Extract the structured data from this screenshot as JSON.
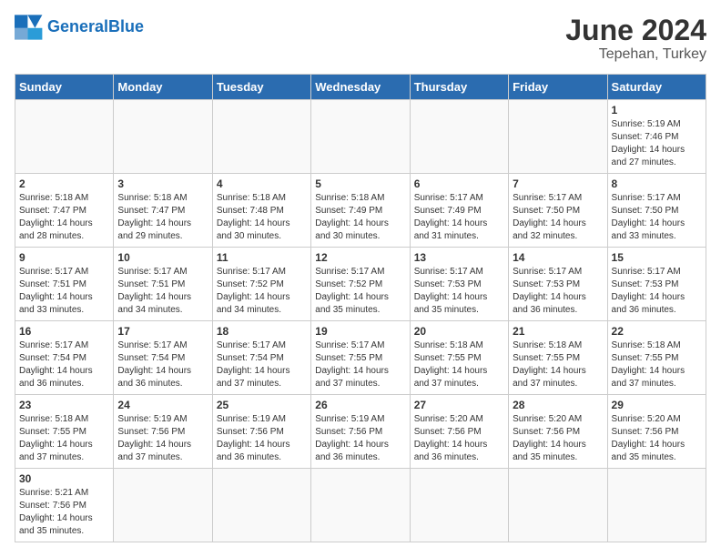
{
  "header": {
    "logo_general": "General",
    "logo_blue": "Blue",
    "month_year": "June 2024",
    "location": "Tepehan, Turkey"
  },
  "weekdays": [
    "Sunday",
    "Monday",
    "Tuesday",
    "Wednesday",
    "Thursday",
    "Friday",
    "Saturday"
  ],
  "weeks": [
    [
      {
        "day": "",
        "info": ""
      },
      {
        "day": "",
        "info": ""
      },
      {
        "day": "",
        "info": ""
      },
      {
        "day": "",
        "info": ""
      },
      {
        "day": "",
        "info": ""
      },
      {
        "day": "",
        "info": ""
      },
      {
        "day": "1",
        "info": "Sunrise: 5:19 AM\nSunset: 7:46 PM\nDaylight: 14 hours\nand 27 minutes."
      }
    ],
    [
      {
        "day": "2",
        "info": "Sunrise: 5:18 AM\nSunset: 7:47 PM\nDaylight: 14 hours\nand 28 minutes."
      },
      {
        "day": "3",
        "info": "Sunrise: 5:18 AM\nSunset: 7:47 PM\nDaylight: 14 hours\nand 29 minutes."
      },
      {
        "day": "4",
        "info": "Sunrise: 5:18 AM\nSunset: 7:48 PM\nDaylight: 14 hours\nand 30 minutes."
      },
      {
        "day": "5",
        "info": "Sunrise: 5:18 AM\nSunset: 7:49 PM\nDaylight: 14 hours\nand 30 minutes."
      },
      {
        "day": "6",
        "info": "Sunrise: 5:17 AM\nSunset: 7:49 PM\nDaylight: 14 hours\nand 31 minutes."
      },
      {
        "day": "7",
        "info": "Sunrise: 5:17 AM\nSunset: 7:50 PM\nDaylight: 14 hours\nand 32 minutes."
      },
      {
        "day": "8",
        "info": "Sunrise: 5:17 AM\nSunset: 7:50 PM\nDaylight: 14 hours\nand 33 minutes."
      }
    ],
    [
      {
        "day": "9",
        "info": "Sunrise: 5:17 AM\nSunset: 7:51 PM\nDaylight: 14 hours\nand 33 minutes."
      },
      {
        "day": "10",
        "info": "Sunrise: 5:17 AM\nSunset: 7:51 PM\nDaylight: 14 hours\nand 34 minutes."
      },
      {
        "day": "11",
        "info": "Sunrise: 5:17 AM\nSunset: 7:52 PM\nDaylight: 14 hours\nand 34 minutes."
      },
      {
        "day": "12",
        "info": "Sunrise: 5:17 AM\nSunset: 7:52 PM\nDaylight: 14 hours\nand 35 minutes."
      },
      {
        "day": "13",
        "info": "Sunrise: 5:17 AM\nSunset: 7:53 PM\nDaylight: 14 hours\nand 35 minutes."
      },
      {
        "day": "14",
        "info": "Sunrise: 5:17 AM\nSunset: 7:53 PM\nDaylight: 14 hours\nand 36 minutes."
      },
      {
        "day": "15",
        "info": "Sunrise: 5:17 AM\nSunset: 7:53 PM\nDaylight: 14 hours\nand 36 minutes."
      }
    ],
    [
      {
        "day": "16",
        "info": "Sunrise: 5:17 AM\nSunset: 7:54 PM\nDaylight: 14 hours\nand 36 minutes."
      },
      {
        "day": "17",
        "info": "Sunrise: 5:17 AM\nSunset: 7:54 PM\nDaylight: 14 hours\nand 36 minutes."
      },
      {
        "day": "18",
        "info": "Sunrise: 5:17 AM\nSunset: 7:54 PM\nDaylight: 14 hours\nand 37 minutes."
      },
      {
        "day": "19",
        "info": "Sunrise: 5:17 AM\nSunset: 7:55 PM\nDaylight: 14 hours\nand 37 minutes."
      },
      {
        "day": "20",
        "info": "Sunrise: 5:18 AM\nSunset: 7:55 PM\nDaylight: 14 hours\nand 37 minutes."
      },
      {
        "day": "21",
        "info": "Sunrise: 5:18 AM\nSunset: 7:55 PM\nDaylight: 14 hours\nand 37 minutes."
      },
      {
        "day": "22",
        "info": "Sunrise: 5:18 AM\nSunset: 7:55 PM\nDaylight: 14 hours\nand 37 minutes."
      }
    ],
    [
      {
        "day": "23",
        "info": "Sunrise: 5:18 AM\nSunset: 7:55 PM\nDaylight: 14 hours\nand 37 minutes."
      },
      {
        "day": "24",
        "info": "Sunrise: 5:19 AM\nSunset: 7:56 PM\nDaylight: 14 hours\nand 37 minutes."
      },
      {
        "day": "25",
        "info": "Sunrise: 5:19 AM\nSunset: 7:56 PM\nDaylight: 14 hours\nand 36 minutes."
      },
      {
        "day": "26",
        "info": "Sunrise: 5:19 AM\nSunset: 7:56 PM\nDaylight: 14 hours\nand 36 minutes."
      },
      {
        "day": "27",
        "info": "Sunrise: 5:20 AM\nSunset: 7:56 PM\nDaylight: 14 hours\nand 36 minutes."
      },
      {
        "day": "28",
        "info": "Sunrise: 5:20 AM\nSunset: 7:56 PM\nDaylight: 14 hours\nand 35 minutes."
      },
      {
        "day": "29",
        "info": "Sunrise: 5:20 AM\nSunset: 7:56 PM\nDaylight: 14 hours\nand 35 minutes."
      }
    ],
    [
      {
        "day": "30",
        "info": "Sunrise: 5:21 AM\nSunset: 7:56 PM\nDaylight: 14 hours\nand 35 minutes."
      },
      {
        "day": "",
        "info": ""
      },
      {
        "day": "",
        "info": ""
      },
      {
        "day": "",
        "info": ""
      },
      {
        "day": "",
        "info": ""
      },
      {
        "day": "",
        "info": ""
      },
      {
        "day": "",
        "info": ""
      }
    ]
  ]
}
